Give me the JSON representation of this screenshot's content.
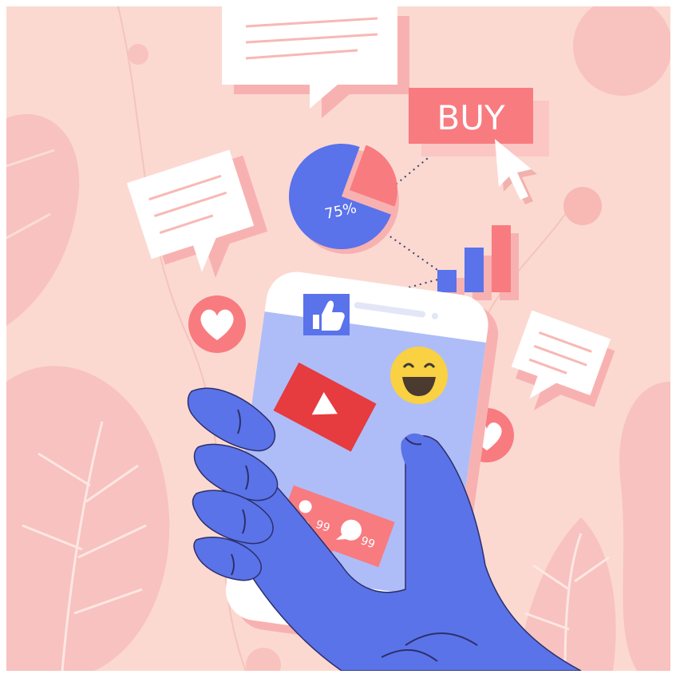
{
  "scene": {
    "buy_label": "BUY",
    "pie": {
      "percent_label": "75%",
      "share": 0.75
    },
    "bars": {
      "values": [
        3,
        6,
        9
      ]
    },
    "notification": {
      "followers_count": "99",
      "comments_count": "99"
    }
  },
  "colors": {
    "background": "#fbd9d1",
    "blob": "#f7c2c0",
    "blob_light": "#fde7e2",
    "accent_red": "#f87b80",
    "shadow_red": "#f8b1b1",
    "blue": "#5a72ea",
    "screen": "#aebdf7",
    "hand": "#5b73e8",
    "emoji": "#f9d142",
    "youtube": "#e63b3f",
    "bubble": "#ffffff"
  },
  "icons": [
    "chat-bubble-icon",
    "heart-icon",
    "thumbs-up-icon",
    "smiling-emoji-icon",
    "play-icon",
    "user-icon",
    "comment-icon",
    "cursor-icon",
    "pie-chart-icon",
    "bar-chart-icon"
  ]
}
